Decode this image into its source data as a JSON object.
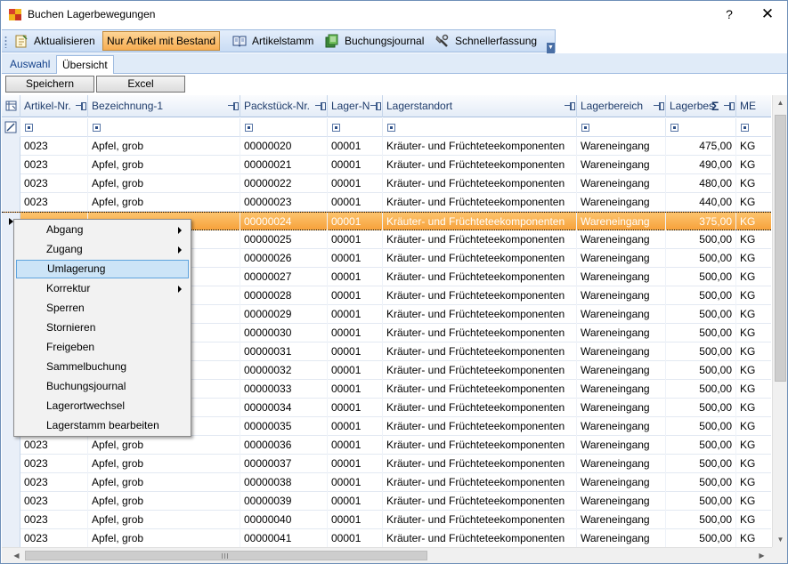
{
  "window": {
    "title": "Buchen Lagerbewegungen",
    "help": "?",
    "close": "✕"
  },
  "toolbar": {
    "items": [
      {
        "label": "Aktualisieren",
        "icon": "refresh-icon"
      },
      {
        "label": "Nur Artikel mit Bestand",
        "icon": "",
        "active": true
      },
      {
        "label": "Artikelstamm",
        "icon": "book-icon"
      },
      {
        "label": "Buchungsjournal",
        "icon": "ledger-icon"
      },
      {
        "label": "Schnellerfassung",
        "icon": "wrench-icon"
      }
    ],
    "overflow": "▼"
  },
  "tabs": [
    {
      "label": "Auswahl",
      "active": false
    },
    {
      "label": "Übersicht",
      "active": true
    }
  ],
  "buttons": {
    "speichern": "Speichern",
    "excel": "Excel"
  },
  "grid": {
    "columns": [
      "Artikel-Nr.",
      "Bezeichnung-1",
      "Packstück-Nr.",
      "Lager-N",
      "Lagerstandort",
      "Lagerbereich",
      "Lagerbes",
      "ME"
    ],
    "sum_symbol": "Σ",
    "rows": [
      [
        "0023",
        "Apfel, grob",
        "00000020",
        "00001",
        "Kräuter- und Früchteteekomponenten",
        "Wareneingang",
        "475,00",
        "KG"
      ],
      [
        "0023",
        "Apfel, grob",
        "00000021",
        "00001",
        "Kräuter- und Früchteteekomponenten",
        "Wareneingang",
        "490,00",
        "KG"
      ],
      [
        "0023",
        "Apfel, grob",
        "00000022",
        "00001",
        "Kräuter- und Früchteteekomponenten",
        "Wareneingang",
        "480,00",
        "KG"
      ],
      [
        "0023",
        "Apfel, grob",
        "00000023",
        "00001",
        "Kräuter- und Früchteteekomponenten",
        "Wareneingang",
        "440,00",
        "KG"
      ],
      [
        "",
        "",
        "00000024",
        "00001",
        "Kräuter- und Früchteteekomponenten",
        "Wareneingang",
        "375,00",
        "KG"
      ],
      [
        "",
        "",
        "00000025",
        "00001",
        "Kräuter- und Früchteteekomponenten",
        "Wareneingang",
        "500,00",
        "KG"
      ],
      [
        "",
        "",
        "00000026",
        "00001",
        "Kräuter- und Früchteteekomponenten",
        "Wareneingang",
        "500,00",
        "KG"
      ],
      [
        "",
        "",
        "00000027",
        "00001",
        "Kräuter- und Früchteteekomponenten",
        "Wareneingang",
        "500,00",
        "KG"
      ],
      [
        "",
        "",
        "00000028",
        "00001",
        "Kräuter- und Früchteteekomponenten",
        "Wareneingang",
        "500,00",
        "KG"
      ],
      [
        "",
        "",
        "00000029",
        "00001",
        "Kräuter- und Früchteteekomponenten",
        "Wareneingang",
        "500,00",
        "KG"
      ],
      [
        "",
        "",
        "00000030",
        "00001",
        "Kräuter- und Früchteteekomponenten",
        "Wareneingang",
        "500,00",
        "KG"
      ],
      [
        "",
        "",
        "00000031",
        "00001",
        "Kräuter- und Früchteteekomponenten",
        "Wareneingang",
        "500,00",
        "KG"
      ],
      [
        "",
        "",
        "00000032",
        "00001",
        "Kräuter- und Früchteteekomponenten",
        "Wareneingang",
        "500,00",
        "KG"
      ],
      [
        "",
        "",
        "00000033",
        "00001",
        "Kräuter- und Früchteteekomponenten",
        "Wareneingang",
        "500,00",
        "KG"
      ],
      [
        "",
        "",
        "00000034",
        "00001",
        "Kräuter- und Früchteteekomponenten",
        "Wareneingang",
        "500,00",
        "KG"
      ],
      [
        "",
        "",
        "00000035",
        "00001",
        "Kräuter- und Früchteteekomponenten",
        "Wareneingang",
        "500,00",
        "KG"
      ],
      [
        "0023",
        "Apfel, grob",
        "00000036",
        "00001",
        "Kräuter- und Früchteteekomponenten",
        "Wareneingang",
        "500,00",
        "KG"
      ],
      [
        "0023",
        "Apfel, grob",
        "00000037",
        "00001",
        "Kräuter- und Früchteteekomponenten",
        "Wareneingang",
        "500,00",
        "KG"
      ],
      [
        "0023",
        "Apfel, grob",
        "00000038",
        "00001",
        "Kräuter- und Früchteteekomponenten",
        "Wareneingang",
        "500,00",
        "KG"
      ],
      [
        "0023",
        "Apfel, grob",
        "00000039",
        "00001",
        "Kräuter- und Früchteteekomponenten",
        "Wareneingang",
        "500,00",
        "KG"
      ],
      [
        "0023",
        "Apfel, grob",
        "00000040",
        "00001",
        "Kräuter- und Früchteteekomponenten",
        "Wareneingang",
        "500,00",
        "KG"
      ],
      [
        "0023",
        "Apfel, grob",
        "00000041",
        "00001",
        "Kräuter- und Früchteteekomponenten",
        "Wareneingang",
        "500,00",
        "KG"
      ]
    ],
    "selected_row": 4
  },
  "context_menu": {
    "items": [
      {
        "label": "Abgang",
        "submenu": true
      },
      {
        "label": "Zugang",
        "submenu": true
      },
      {
        "label": "Umlagerung",
        "submenu": false,
        "highlighted": true
      },
      {
        "label": "Korrektur",
        "submenu": true
      },
      {
        "label": "Sperren",
        "submenu": false
      },
      {
        "label": "Stornieren",
        "submenu": false
      },
      {
        "label": "Freigeben",
        "submenu": false
      },
      {
        "label": "Sammelbuchung",
        "submenu": false
      },
      {
        "label": "Buchungsjournal",
        "submenu": false
      },
      {
        "label": "Lagerortwechsel",
        "submenu": false
      },
      {
        "label": "Lagerstamm bearbeiten",
        "submenu": false
      }
    ]
  },
  "colors": {
    "selection": "#f7a23c",
    "accent": "#15428b",
    "header_text": "#1f3c6b"
  }
}
